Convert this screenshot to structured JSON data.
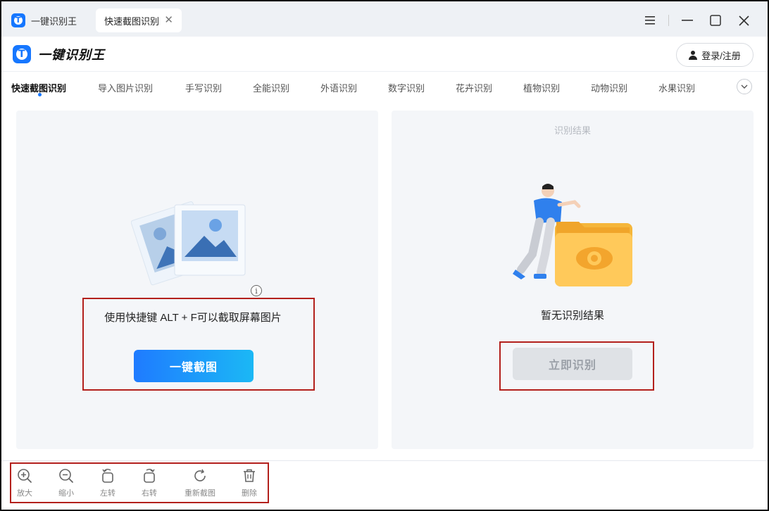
{
  "window": {
    "app_tab_title": "一键识别王",
    "active_tab_title": "快速截图识别",
    "tab_close_glyph": "✕",
    "menu_glyph": "☰",
    "minimize_glyph": "—",
    "maximize_glyph": "☐",
    "close_glyph": "✕"
  },
  "header": {
    "brand_name": "一键识别王",
    "login_label": "登录/注册"
  },
  "tool_tabs": [
    {
      "label": "快速截图识别",
      "active": true
    },
    {
      "label": "导入图片识别",
      "active": false
    },
    {
      "label": "手写识别",
      "active": false
    },
    {
      "label": "全能识别",
      "active": false
    },
    {
      "label": "外语识别",
      "active": false
    },
    {
      "label": "数字识别",
      "active": false
    },
    {
      "label": "花卉识别",
      "active": false
    },
    {
      "label": "植物识别",
      "active": false
    },
    {
      "label": "动物识别",
      "active": false
    },
    {
      "label": "水果识别",
      "active": false
    }
  ],
  "more_glyph": "⌄",
  "left_panel": {
    "hint": "使用快捷键 ALT + F可以截取屏幕图片",
    "info_glyph": "i",
    "capture_button": "一键截图"
  },
  "right_panel": {
    "title": "识别结果",
    "empty_text": "暂无识别结果",
    "recognize_button": "立即识别"
  },
  "toolbar": {
    "zoom_in": "放大",
    "zoom_out": "缩小",
    "rotate_left": "左转",
    "rotate_right": "右转",
    "recapture": "重新截图",
    "delete": "删除"
  },
  "colors": {
    "accent": "#1677ff",
    "highlight_box": "#b3201c"
  }
}
